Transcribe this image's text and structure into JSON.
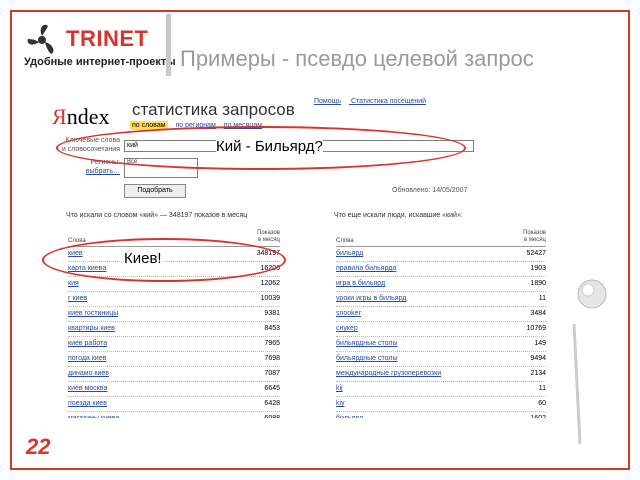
{
  "header": {
    "logo_text": "TRINET",
    "tagline": "Удобные интернет-проекты",
    "title": "Примеры -  псевдо целевой запрос"
  },
  "screenshot": {
    "logo_first": "Я",
    "logo_rest": "ndex",
    "title": "статистика запросов",
    "toplinks": [
      "Помощь",
      "Статистика посещений"
    ],
    "mode_tabs": [
      "по словам",
      "по регионам",
      "по месяцам"
    ],
    "keywords_label_1": "Ключевые слова",
    "keywords_label_2": "и словосочетания",
    "keyword_value": "кий",
    "regions_label": "Регионы:",
    "regions_link": "выбрать…",
    "regions_value": "Все",
    "submit_label": "Подобрать",
    "updated": "Обновлено: 14/05/2007",
    "left_caption": "Что искали со словом «кий» — 348197 показов в месяц",
    "right_caption": "Что еще искали люди, искавшие «кий»:",
    "col_word": "Слова",
    "col_shows_1": "Показов",
    "col_shows_2": "в месяц",
    "left_rows": [
      {
        "kw": "киев",
        "n": "348197"
      },
      {
        "kw": "карта киева",
        "n": "16206"
      },
      {
        "kw": "кия",
        "n": "12062"
      },
      {
        "kw": "г киев",
        "n": "10039"
      },
      {
        "kw": "киев гостиницы",
        "n": "9381"
      },
      {
        "kw": "квартиры киев",
        "n": "8453"
      },
      {
        "kw": "киев работа",
        "n": "7965"
      },
      {
        "kw": "погода киев",
        "n": "7698"
      },
      {
        "kw": "динамо киев",
        "n": "7087"
      },
      {
        "kw": "киев москва",
        "n": "6645"
      },
      {
        "kw": "поезда киев",
        "n": "6428"
      },
      {
        "kw": "магазины киева",
        "n": "6088"
      }
    ],
    "right_rows": [
      {
        "kw": "бильярд",
        "n": "52427"
      },
      {
        "kw": "правила бильярда",
        "n": "1903"
      },
      {
        "kw": "игра в бильярд",
        "n": "1890"
      },
      {
        "kw": "уроки игры в бильярд",
        "n": "11"
      },
      {
        "kw": "snooker",
        "n": "3484"
      },
      {
        "kw": "снукер",
        "n": "10769"
      },
      {
        "kw": "бильярдные столы",
        "n": "149"
      },
      {
        "kw": "бильярдные столы",
        "n": "9494"
      },
      {
        "kw": "международные грузоперевозки",
        "n": "2134"
      },
      {
        "kw": "kij",
        "n": "11"
      },
      {
        "kw": "kiy",
        "n": "60"
      },
      {
        "kw": "бильярд",
        "n": "1602"
      }
    ]
  },
  "callouts": {
    "top": "Кий - Бильярд?",
    "left": "Киев!"
  },
  "slide_number": "22",
  "colors": {
    "accent": "#d9342b",
    "title_gray": "#9a9a9a",
    "link_blue": "#2a4aa8"
  }
}
